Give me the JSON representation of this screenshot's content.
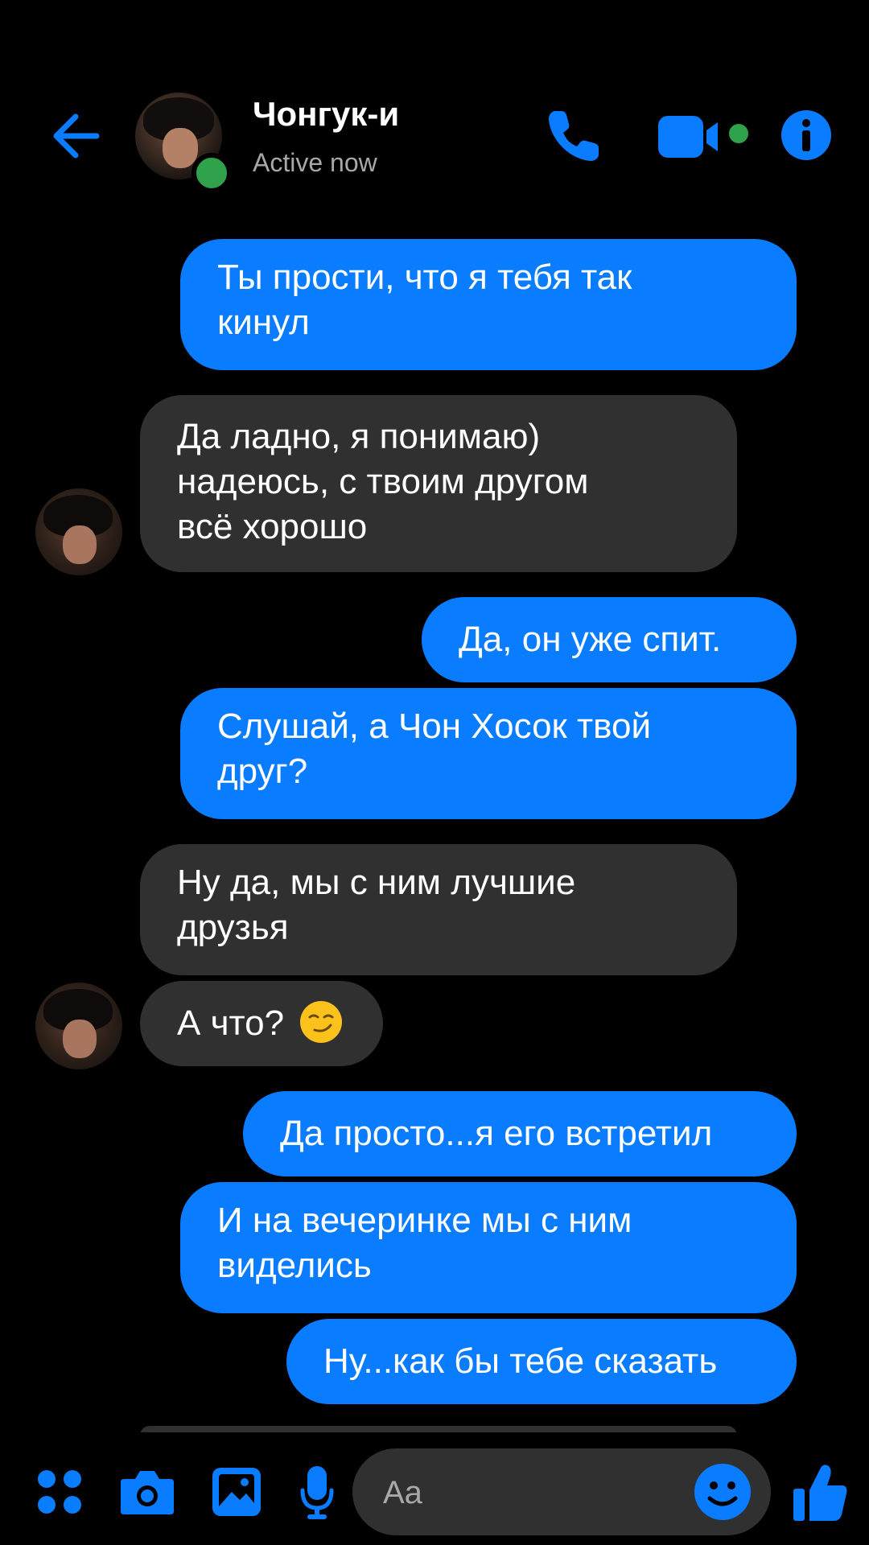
{
  "header": {
    "contact_name": "Чонгук-и",
    "status": "Active now",
    "icons": [
      "back-arrow-icon",
      "phone-icon",
      "video-camera-icon",
      "info-icon"
    ]
  },
  "messages": [
    {
      "direction": "outgoing",
      "lines": [
        "Ты прости, что я тебя так",
        "кинул"
      ]
    },
    {
      "direction": "incoming",
      "lines": [
        "Да ладно, я понимаю)",
        "надеюсь, с твоим другом",
        "всё хорошо"
      ]
    },
    {
      "direction": "outgoing",
      "lines": [
        "Да, он уже спит."
      ]
    },
    {
      "direction": "outgoing",
      "lines": [
        "Слушай, а Чон Хосок твой",
        "друг?"
      ]
    },
    {
      "direction": "incoming",
      "lines": [
        "Ну да, мы с ним лучшие",
        "друзья"
      ]
    },
    {
      "direction": "incoming",
      "text": "А что?",
      "emoji": "smirking-face"
    },
    {
      "direction": "outgoing",
      "lines": [
        "Да просто...я его встретил"
      ]
    },
    {
      "direction": "outgoing",
      "lines": [
        "И на вечеринке мы с ним",
        "виделись"
      ]
    },
    {
      "direction": "outgoing",
      "lines": [
        "Ну...как бы тебе сказать"
      ]
    }
  ],
  "composer": {
    "placeholder": "Aa",
    "icons": [
      "apps-menu-icon",
      "camera-icon",
      "gallery-icon",
      "microphone-icon",
      "emoji-icon",
      "thumbs-up-icon"
    ]
  },
  "colors": {
    "accent": "#0a7cff",
    "incoming_bubble": "#303030",
    "background": "#000000",
    "online": "#31a24c",
    "status_text": "#a8a8a8"
  }
}
